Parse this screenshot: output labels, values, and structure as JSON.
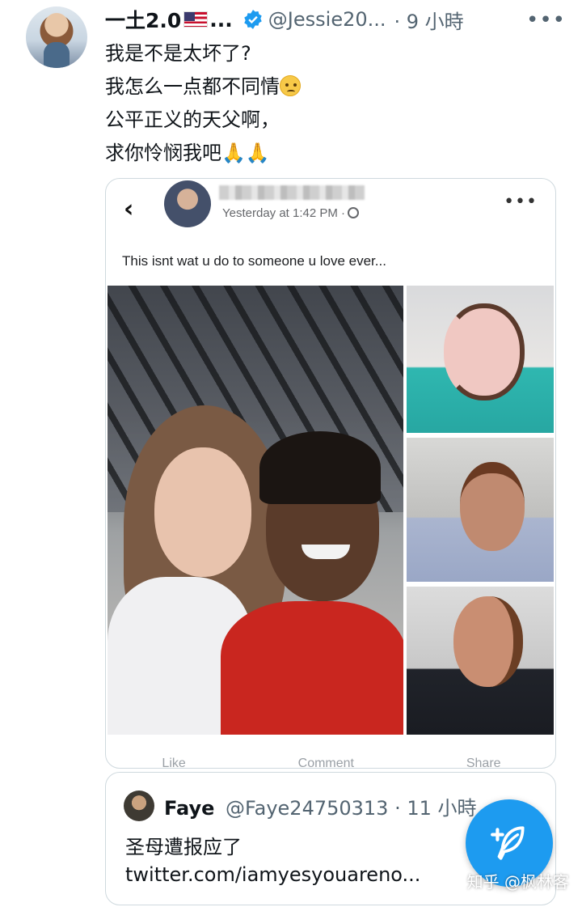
{
  "tweet": {
    "display_name": "一土2.0",
    "name_suffix": "...",
    "handle": "@Jessie20...",
    "time": "· 9 小時",
    "more": "•••",
    "lines": [
      "我是不是太坏了?",
      "我怎么一点都不同情",
      "公平正义的天父啊，",
      "求你怜悯我吧"
    ],
    "line2_emoji": "face-with-rolling-eyes-icon",
    "line4_emoji": "🙏🙏"
  },
  "embedded_post": {
    "back": "‹",
    "time": "Yesterday at 1:42 PM ·",
    "more": "•••",
    "caption": "This isnt wat u do to someone u love ever...",
    "actions": [
      "Like",
      "Comment",
      "Share"
    ]
  },
  "quoted_tweet": {
    "name": "Faye",
    "handle": "@Faye24750313",
    "time": "· 11 小時",
    "text": "圣母遭报应了",
    "link": "twitter.com/iamyesyouareno..."
  },
  "watermark": "知乎 @枫林客",
  "colors": {
    "accent": "#1d9bf0",
    "secondary_text": "#536471",
    "primary_text": "#0f1419"
  }
}
